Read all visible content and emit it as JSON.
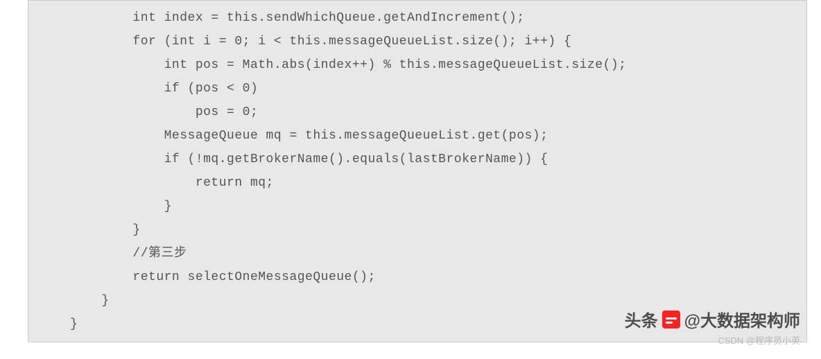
{
  "code": {
    "lines": [
      "        int index = this.sendWhichQueue.getAndIncrement();",
      "        for (int i = 0; i < this.messageQueueList.size(); i++) {",
      "            int pos = Math.abs(index++) % this.messageQueueList.size();",
      "            if (pos < 0)",
      "                pos = 0;",
      "            MessageQueue mq = this.messageQueueList.get(pos);",
      "            if (!mq.getBrokerName().equals(lastBrokerName)) {",
      "                return mq;",
      "            }",
      "        }",
      "        //第三步",
      "        return selectOneMessageQueue();",
      "    }",
      "}"
    ]
  },
  "watermark1": {
    "prefix": "头条",
    "text": "@大数据架构师"
  },
  "watermark2": "CSDN @程序员小英"
}
